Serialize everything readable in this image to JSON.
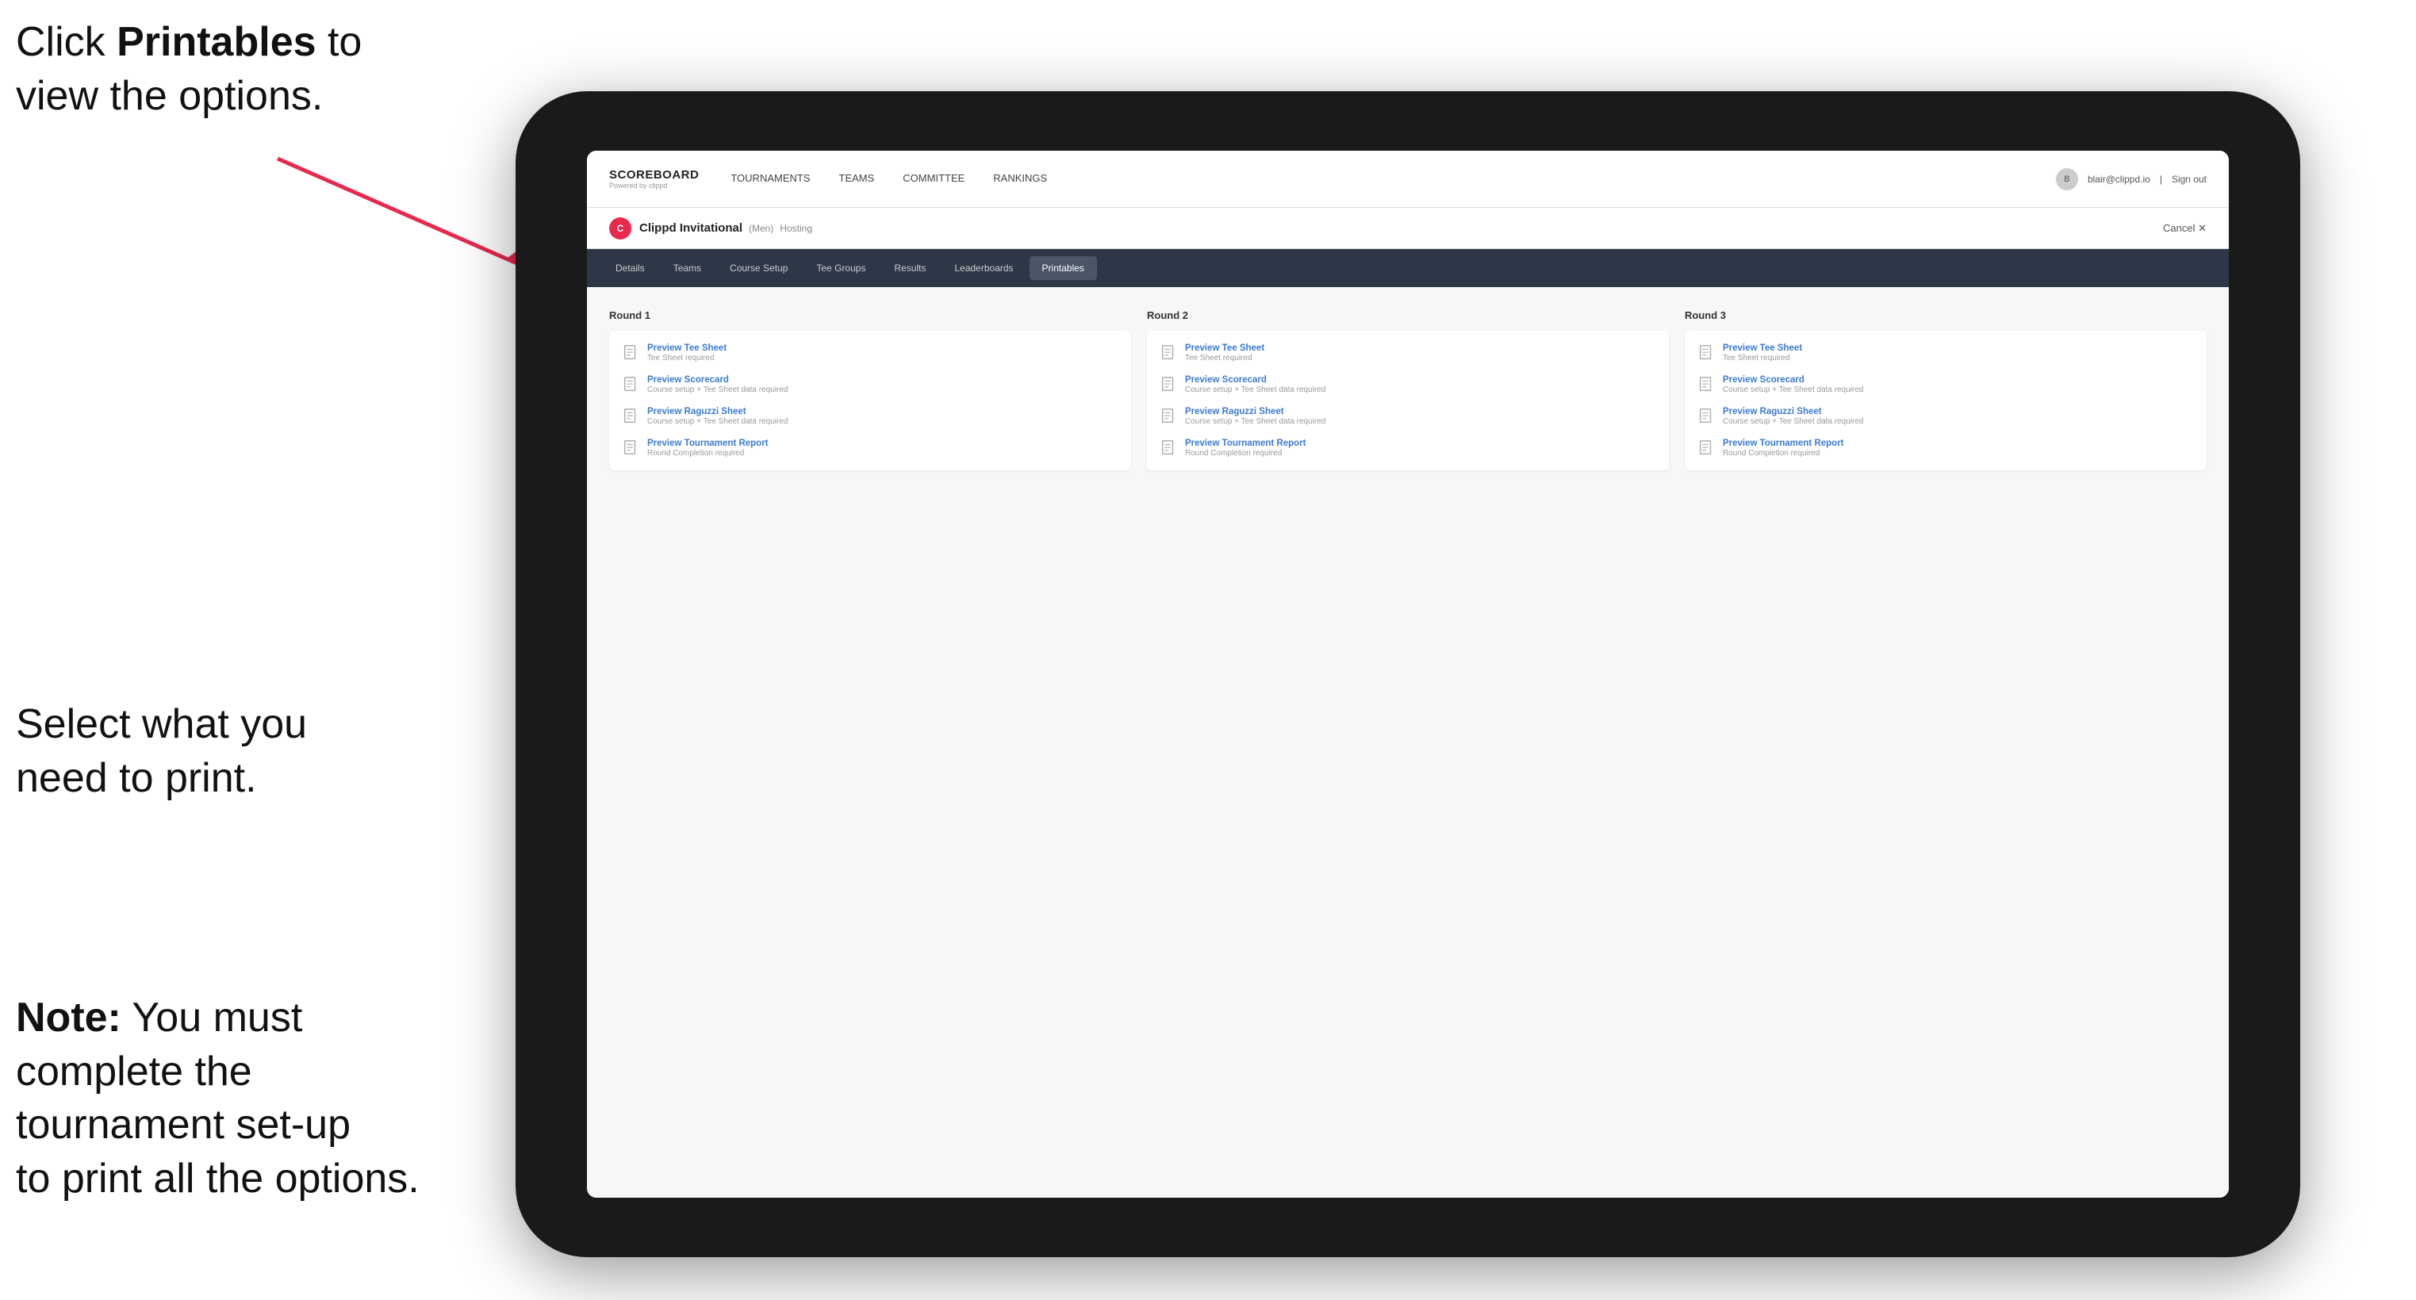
{
  "instructions": {
    "top_line1": "Click ",
    "top_bold": "Printables",
    "top_line2": " to",
    "top_line3": "view the options.",
    "middle_line1": "Select what you",
    "middle_line2": "need to print.",
    "bottom_bold": "Note:",
    "bottom_line1": " You must",
    "bottom_line2": "complete the",
    "bottom_line3": "tournament set-up",
    "bottom_line4": "to print all the options."
  },
  "nav": {
    "logo": "SCOREBOARD",
    "powered_by": "Powered by clippd",
    "links": [
      "TOURNAMENTS",
      "TEAMS",
      "COMMITTEE",
      "RANKINGS"
    ],
    "user_email": "blair@clippd.io",
    "sign_out": "Sign out"
  },
  "tournament": {
    "logo_letter": "C",
    "name": "Clippd Invitational",
    "gender": "(Men)",
    "status": "Hosting",
    "cancel_label": "Cancel ✕"
  },
  "tabs": [
    {
      "label": "Details",
      "active": false
    },
    {
      "label": "Teams",
      "active": false
    },
    {
      "label": "Course Setup",
      "active": false
    },
    {
      "label": "Tee Groups",
      "active": false
    },
    {
      "label": "Results",
      "active": false
    },
    {
      "label": "Leaderboards",
      "active": false
    },
    {
      "label": "Printables",
      "active": true
    }
  ],
  "rounds": [
    {
      "title": "Round 1",
      "items": [
        {
          "title": "Preview Tee Sheet",
          "subtitle": "Tee Sheet required"
        },
        {
          "title": "Preview Scorecard",
          "subtitle": "Course setup + Tee Sheet data required"
        },
        {
          "title": "Preview Raguzzi Sheet",
          "subtitle": "Course setup + Tee Sheet data required"
        },
        {
          "title": "Preview Tournament Report",
          "subtitle": "Round Completion required"
        }
      ]
    },
    {
      "title": "Round 2",
      "items": [
        {
          "title": "Preview Tee Sheet",
          "subtitle": "Tee Sheet required"
        },
        {
          "title": "Preview Scorecard",
          "subtitle": "Course setup + Tee Sheet data required"
        },
        {
          "title": "Preview Raguzzi Sheet",
          "subtitle": "Course setup + Tee Sheet data required"
        },
        {
          "title": "Preview Tournament Report",
          "subtitle": "Round Completion required"
        }
      ]
    },
    {
      "title": "Round 3",
      "items": [
        {
          "title": "Preview Tee Sheet",
          "subtitle": "Tee Sheet required"
        },
        {
          "title": "Preview Scorecard",
          "subtitle": "Course setup + Tee Sheet data required"
        },
        {
          "title": "Preview Raguzzi Sheet",
          "subtitle": "Course setup + Tee Sheet data required"
        },
        {
          "title": "Preview Tournament Report",
          "subtitle": "Round Completion required"
        }
      ]
    }
  ]
}
